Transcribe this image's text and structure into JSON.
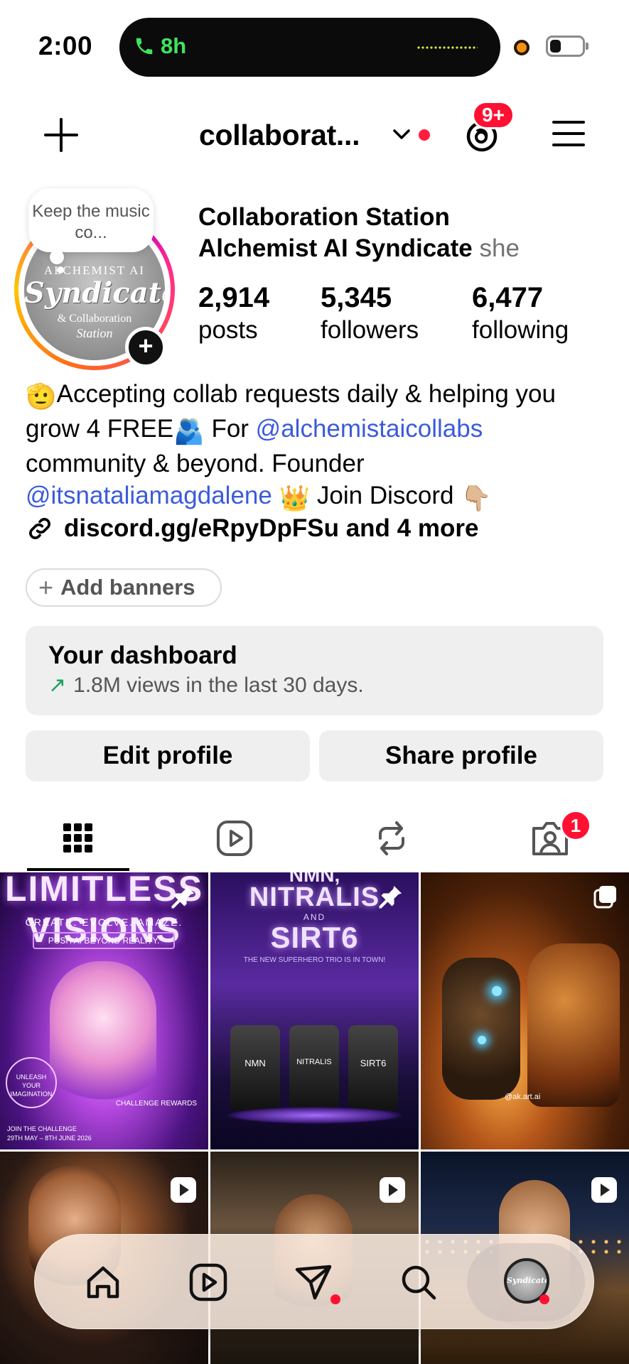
{
  "status_bar": {
    "time": "2:00",
    "call_duration": "8h",
    "battery_level": 0.35
  },
  "header": {
    "username": "collaborat...",
    "threads_badge": "9+"
  },
  "profile": {
    "note": "Keep the music co...",
    "avatar_text": {
      "top": "ALCHEMIST AI",
      "main": "Syndicate",
      "sub": "& Collaboration",
      "sub2": "Station"
    },
    "display_name_line1": "Collaboration Station",
    "display_name_line2": "Alchemist AI Syndicate",
    "pronouns": "she",
    "stats": [
      {
        "value": "2,914",
        "label": "posts"
      },
      {
        "value": "5,345",
        "label": "followers"
      },
      {
        "value": "6,477",
        "label": "following"
      }
    ]
  },
  "bio": {
    "emoji_start": "🫡",
    "part1": "Accepting collab requests daily & helping you grow 4 FREE",
    "emoji_people": "🫂",
    "part2": " For ",
    "mention1": "@alchemistaicollabs",
    "part3": " community & beyond. Founder ",
    "mention2": "@itsnataliamagdalene",
    "emoji_crown": "👑",
    "part4": " Join Discord ",
    "emoji_point": "👇🏼"
  },
  "links": {
    "text": "discord.gg/eRpyDpFSu and 4 more"
  },
  "banners": {
    "label": "Add banners"
  },
  "dashboard": {
    "title": "Your dashboard",
    "subtitle": "1.8M views in the last 30 days."
  },
  "actions": {
    "edit": "Edit profile",
    "share": "Share profile"
  },
  "tabs": {
    "tagged_badge": "1"
  },
  "grid": {
    "tile1": {
      "title": "LIMITLESS VISIONS",
      "tagline": "CREATE. EVOLVE. AMAZE.",
      "cta": "PUSH AI BEYOND REALITY.",
      "badge": "UNLEASH YOUR IMAGINATION",
      "rewards": "CHALLENGE REWARDS",
      "join": "JOIN THE CHALLENGE",
      "dates": "29TH MAY – 8TH JUNE 2026"
    },
    "tile2": {
      "title_top": "NMN,",
      "title_main": "NITRALIS",
      "title_and": "AND",
      "title_end": "SIRT6",
      "tagline": "THE NEW SUPERHERO TRIO IS IN TOWN!",
      "bottles": [
        "NMN",
        "NITRALIS",
        "SIRT6"
      ]
    },
    "tile3": {
      "watermark": "@ak.art.ai"
    }
  },
  "colors": {
    "accent_link": "#3b5bdb",
    "badge_red": "#ff1033",
    "call_green": "#3ee55d",
    "button_gray": "#efefef"
  },
  "icons": {
    "header": [
      "plus-icon",
      "chevron-down-icon",
      "threads-icon",
      "hamburger-menu-icon"
    ],
    "tabs": [
      "grid-icon",
      "reels-icon",
      "reposts-icon",
      "tagged-icon"
    ],
    "nav": [
      "home-icon",
      "reels-icon",
      "send-icon",
      "search-icon",
      "profile-avatar"
    ]
  }
}
